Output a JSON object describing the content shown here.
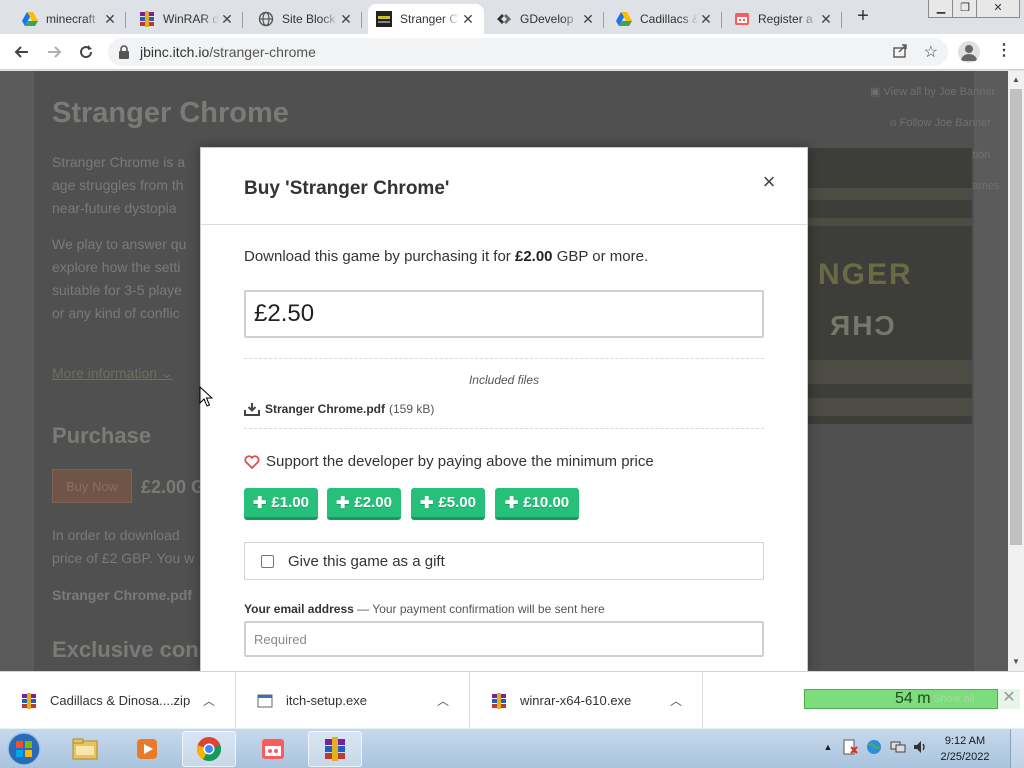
{
  "browser": {
    "tabs": [
      {
        "label": "minecraft",
        "active": false
      },
      {
        "label": "WinRAR d",
        "active": false
      },
      {
        "label": "Site Block",
        "active": false
      },
      {
        "label": "Stranger C",
        "active": true
      },
      {
        "label": "GDevelop",
        "active": false
      },
      {
        "label": "Cadillacs &",
        "active": false
      },
      {
        "label": "Register a",
        "active": false
      }
    ],
    "url_host": "jbinc.itch.io",
    "url_path": "/stranger-chrome"
  },
  "background_page": {
    "title": "Stranger Chrome",
    "para1_lines": [
      "Stranger Chrome is a",
      "age struggles from th",
      "near-future dystopia"
    ],
    "para2_lines": [
      "We play to answer qu",
      "explore how the setti",
      "suitable for 3-5 playe",
      "or any kind of conflic"
    ],
    "more_info": "More information",
    "purchase_heading": "Purchase",
    "buy_now": "Buy Now",
    "price": "£2.00 G",
    "para3_lines": [
      "In order to download",
      "price of £2 GBP. You w"
    ],
    "file_line": "Stranger Chrome.pdf",
    "exclusive_heading": "Exclusive con",
    "sidebar": [
      "View all by Joe Banner",
      "Follow Joe Banner",
      "Add To Collection",
      "Related games"
    ],
    "cover_word": "NGER",
    "cover_word2": "CHR"
  },
  "modal": {
    "title": "Buy 'Stranger Chrome'",
    "intro_prefix": "Download this game by purchasing it for ",
    "intro_price": "£2.00",
    "intro_suffix": " GBP or more.",
    "price_value": "£2.50",
    "included_files_title": "Included files",
    "file_name": "Stranger Chrome.pdf",
    "file_size": "(159 kB)",
    "support_text": "Support the developer by paying above the minimum price",
    "tip_buttons": [
      "£1.00",
      "£2.00",
      "£5.00",
      "£10.00"
    ],
    "gift_label": "Give this game as a gift",
    "email_label": "Your email address",
    "email_note": " — Your payment confirmation will be sent here",
    "email_placeholder": "Required"
  },
  "downloads": {
    "items": [
      "Cadillacs & Dinosa....zip",
      "itch-setup.exe",
      "winrar-x64-610.exe"
    ],
    "progress_text": "54 m",
    "show_all": "Show all"
  },
  "taskbar": {
    "time": "9:12 AM",
    "date": "2/25/2022"
  },
  "colors": {
    "accent_green": "#27c07a",
    "heart_red": "#d9534f"
  }
}
